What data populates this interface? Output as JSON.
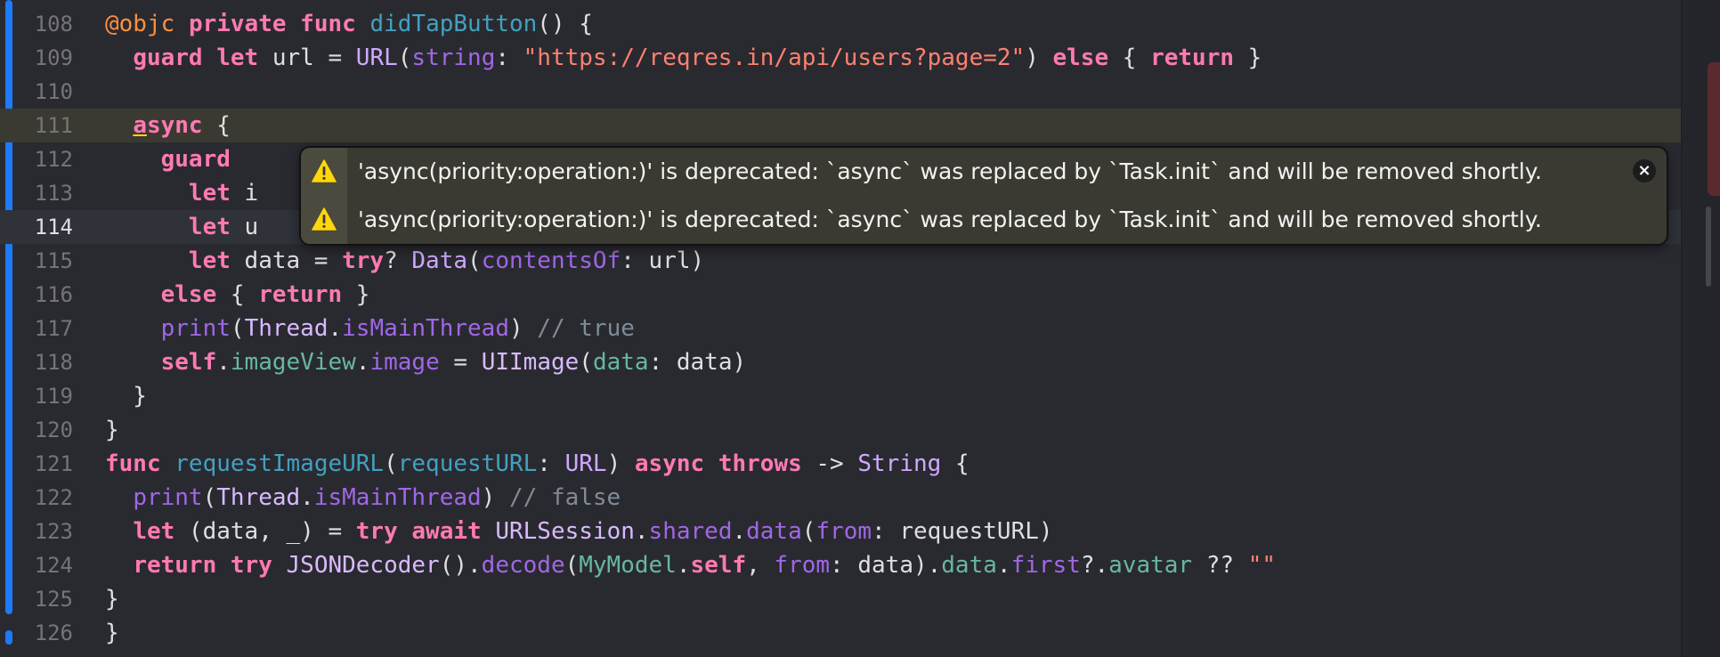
{
  "editor": {
    "lines": [
      {
        "number": "108",
        "tokens": [
          [
            "attr",
            "@objc"
          ],
          [
            "plain",
            " "
          ],
          [
            "kw",
            "private"
          ],
          [
            "plain",
            " "
          ],
          [
            "kw",
            "func"
          ],
          [
            "plain",
            " "
          ],
          [
            "fndef",
            "didTapButton"
          ],
          [
            "plain",
            "() {"
          ]
        ]
      },
      {
        "number": "109",
        "tokens": [
          [
            "plain",
            "  "
          ],
          [
            "kw",
            "guard"
          ],
          [
            "plain",
            " "
          ],
          [
            "kw",
            "let"
          ],
          [
            "plain",
            " url = "
          ],
          [
            "type",
            "URL"
          ],
          [
            "plain",
            "("
          ],
          [
            "method",
            "string"
          ],
          [
            "plain",
            ": "
          ],
          [
            "str",
            "\"https://reqres.in/api/users?page=2\""
          ],
          [
            "plain",
            ") "
          ],
          [
            "kw",
            "else"
          ],
          [
            "plain",
            " { "
          ],
          [
            "kw",
            "return"
          ],
          [
            "plain",
            " }"
          ]
        ]
      },
      {
        "number": "110",
        "tokens": []
      },
      {
        "number": "111",
        "highlight": true,
        "tokens": [
          [
            "plain",
            "  "
          ],
          [
            "warnkw",
            "a"
          ],
          [
            "kw",
            "sync"
          ],
          [
            "plain",
            " {"
          ]
        ]
      },
      {
        "number": "112",
        "tokens": [
          [
            "plain",
            "    "
          ],
          [
            "kw",
            "guard"
          ]
        ]
      },
      {
        "number": "113",
        "tokens": [
          [
            "plain",
            "      "
          ],
          [
            "kw",
            "let"
          ],
          [
            "plain",
            " i"
          ]
        ]
      },
      {
        "number": "114",
        "current": true,
        "tokens": [
          [
            "plain",
            "      "
          ],
          [
            "kw",
            "let"
          ],
          [
            "plain",
            " u"
          ]
        ]
      },
      {
        "number": "115",
        "tokens": [
          [
            "plain",
            "      "
          ],
          [
            "kw",
            "let"
          ],
          [
            "plain",
            " data = "
          ],
          [
            "kw",
            "try"
          ],
          [
            "plain",
            "? "
          ],
          [
            "type",
            "Data"
          ],
          [
            "plain",
            "("
          ],
          [
            "method",
            "contentsOf"
          ],
          [
            "plain",
            ": url)"
          ]
        ]
      },
      {
        "number": "116",
        "tokens": [
          [
            "plain",
            "    "
          ],
          [
            "kw",
            "else"
          ],
          [
            "plain",
            " { "
          ],
          [
            "kw",
            "return"
          ],
          [
            "plain",
            " }"
          ]
        ]
      },
      {
        "number": "117",
        "tokens": [
          [
            "plain",
            "    "
          ],
          [
            "method",
            "print"
          ],
          [
            "plain",
            "("
          ],
          [
            "type2",
            "Thread"
          ],
          [
            "plain",
            "."
          ],
          [
            "method",
            "isMainThread"
          ],
          [
            "plain",
            ") "
          ],
          [
            "com",
            "// true"
          ]
        ]
      },
      {
        "number": "118",
        "tokens": [
          [
            "plain",
            "    "
          ],
          [
            "kw",
            "self"
          ],
          [
            "plain",
            "."
          ],
          [
            "prop",
            "imageView"
          ],
          [
            "plain",
            "."
          ],
          [
            "method",
            "image"
          ],
          [
            "plain",
            " = "
          ],
          [
            "type2",
            "UIImage"
          ],
          [
            "plain",
            "("
          ],
          [
            "prop",
            "data"
          ],
          [
            "plain",
            ": data)"
          ]
        ]
      },
      {
        "number": "119",
        "tokens": [
          [
            "plain",
            "  }"
          ]
        ]
      },
      {
        "number": "120",
        "tokens": [
          [
            "plain",
            "}"
          ]
        ]
      },
      {
        "number": "121",
        "tokens": [
          [
            "kw",
            "func"
          ],
          [
            "plain",
            " "
          ],
          [
            "fndef",
            "requestImageURL"
          ],
          [
            "plain",
            "("
          ],
          [
            "fndef",
            "requestURL"
          ],
          [
            "plain",
            ": "
          ],
          [
            "type",
            "URL"
          ],
          [
            "plain",
            ") "
          ],
          [
            "kw",
            "async"
          ],
          [
            "plain",
            " "
          ],
          [
            "kw",
            "throws"
          ],
          [
            "plain",
            " -> "
          ],
          [
            "type",
            "String"
          ],
          [
            "plain",
            " {"
          ]
        ]
      },
      {
        "number": "122",
        "tokens": [
          [
            "plain",
            "  "
          ],
          [
            "method",
            "print"
          ],
          [
            "plain",
            "("
          ],
          [
            "type2",
            "Thread"
          ],
          [
            "plain",
            "."
          ],
          [
            "method",
            "isMainThread"
          ],
          [
            "plain",
            ") "
          ],
          [
            "com",
            "// false"
          ]
        ]
      },
      {
        "number": "123",
        "tokens": [
          [
            "plain",
            "  "
          ],
          [
            "kw",
            "let"
          ],
          [
            "plain",
            " (data, _) = "
          ],
          [
            "kw",
            "try"
          ],
          [
            "plain",
            " "
          ],
          [
            "kw",
            "await"
          ],
          [
            "plain",
            " "
          ],
          [
            "type2",
            "URLSession"
          ],
          [
            "plain",
            "."
          ],
          [
            "method",
            "shared"
          ],
          [
            "plain",
            "."
          ],
          [
            "method",
            "data"
          ],
          [
            "plain",
            "("
          ],
          [
            "method",
            "from"
          ],
          [
            "plain",
            ": requestURL)"
          ]
        ]
      },
      {
        "number": "124",
        "tokens": [
          [
            "plain",
            "  "
          ],
          [
            "kw",
            "return"
          ],
          [
            "plain",
            " "
          ],
          [
            "kw",
            "try"
          ],
          [
            "plain",
            " "
          ],
          [
            "type2",
            "JSONDecoder"
          ],
          [
            "plain",
            "()."
          ],
          [
            "method",
            "decode"
          ],
          [
            "plain",
            "("
          ],
          [
            "prop",
            "MyModel"
          ],
          [
            "plain",
            "."
          ],
          [
            "kw",
            "self"
          ],
          [
            "plain",
            ", "
          ],
          [
            "method",
            "from"
          ],
          [
            "plain",
            ": data)."
          ],
          [
            "prop",
            "data"
          ],
          [
            "plain",
            "."
          ],
          [
            "method",
            "first"
          ],
          [
            "plain",
            "?."
          ],
          [
            "prop",
            "avatar"
          ],
          [
            "plain",
            " ?? "
          ],
          [
            "str",
            "\"\""
          ]
        ]
      },
      {
        "number": "125",
        "tokens": [
          [
            "plain",
            "}"
          ]
        ]
      },
      {
        "number": "126",
        "tokens": [
          [
            "plain",
            "}"
          ]
        ]
      }
    ]
  },
  "issues": {
    "items": [
      {
        "text": "'async(priority:operation:)' is deprecated: `async` was replaced by `Task.init` and will be removed shortly.",
        "icon": "warning-icon"
      },
      {
        "text": "'async(priority:operation:)' is deprecated: `async` was replaced by `Task.init` and will be removed shortly.",
        "icon": "warning-icon"
      }
    ],
    "close_label": "×"
  },
  "colors": {
    "background": "#292A30",
    "keyword": "#FF7AB2",
    "string": "#FF8170",
    "comment": "#7F8C98",
    "warning": "#FFD60A",
    "change_bar": "#1D7BF7"
  }
}
